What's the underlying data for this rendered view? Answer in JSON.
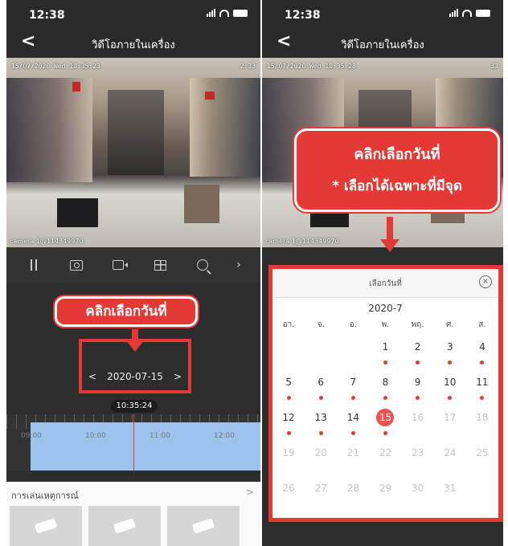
{
  "left": {
    "status": {
      "time": "12:38"
    },
    "nav": {
      "back": "<",
      "title": "วิดีโอภายในเครื่อง"
    },
    "video": {
      "osd_time": "15/07/2020 Wed 10:35:23",
      "osd_right": "2:33",
      "camera_label": "camera 1@114349970"
    },
    "callout": "คลิกเลือกวันที่",
    "date": {
      "prev": "<",
      "value": "2020-07-15",
      "next": ">"
    },
    "current_time": "10:35:24",
    "timeline_labels": [
      "09:00",
      "10:00",
      "11:00",
      "12:00"
    ],
    "events": {
      "title": "การเล่นเหตุการณ์",
      "chevron": ">"
    }
  },
  "right": {
    "status": {
      "time": "12:38"
    },
    "nav": {
      "back": "<",
      "title": "วิดีโอภายในเครื่อง"
    },
    "video": {
      "osd_time": "15/07/2020 Wed 10:35:28",
      "osd_right": "33",
      "camera_label": "camera 1@114349970"
    },
    "callout_line1": "คลิกเลือกวันที่",
    "callout_line2": "* เลือกได้เฉพาะที่มีจุด",
    "calendar": {
      "title": "เลือกวันที่",
      "close": "×",
      "month": "2020-7",
      "weekdays": [
        "อา.",
        "จ.",
        "อ.",
        "พ.",
        "พฤ.",
        "ศ.",
        "ส."
      ],
      "days": [
        "",
        "",
        "",
        "1",
        "2",
        "3",
        "4",
        "5",
        "6",
        "7",
        "8",
        "9",
        "10",
        "11",
        "12",
        "13",
        "14",
        "15",
        "16",
        "17",
        "18",
        "19",
        "20",
        "21",
        "22",
        "23",
        "24",
        "25",
        "26",
        "27",
        "28",
        "29",
        "30",
        "31",
        ""
      ],
      "days_with_recordings": [
        "1",
        "2",
        "3",
        "4",
        "5",
        "6",
        "7",
        "8",
        "9",
        "10",
        "11",
        "12",
        "13",
        "14",
        "15"
      ],
      "selected": "15",
      "accent_color": "#e53935"
    }
  }
}
